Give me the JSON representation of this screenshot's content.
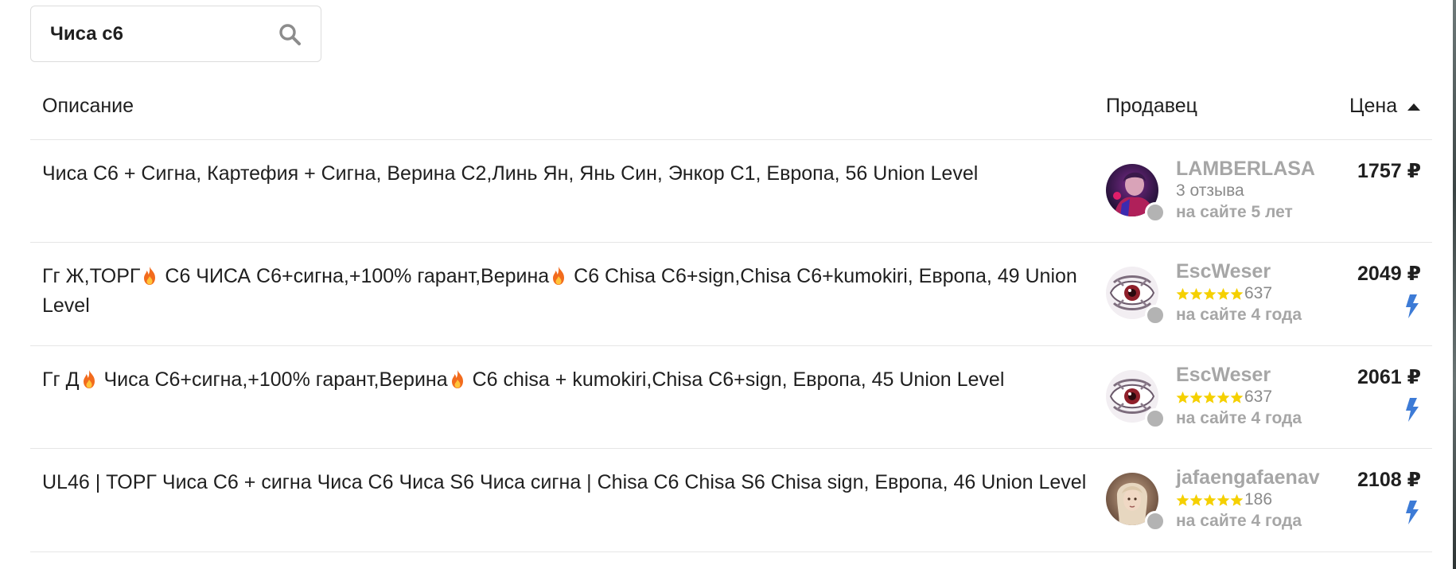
{
  "search": {
    "value": "Чиса с6"
  },
  "table": {
    "headers": {
      "description": "Описание",
      "seller": "Продавец",
      "price": "Цена"
    },
    "sort": {
      "column": "price",
      "direction": "ascending"
    },
    "rows": [
      {
        "segments": [
          "Чиса С6 + Сигна, Картефия + Сигна, Верина С2,Линь Ян, Янь Син, Энкор С1, Европа, 56 Union Level"
        ],
        "seller": {
          "name": "LAMBERLASA",
          "reviews": "3 отзыва",
          "stars": false,
          "since": "на сайте 5 лет",
          "avatar": "dark-character"
        },
        "price": "1757 ₽",
        "auto_delivery": false
      },
      {
        "segments": [
          "Гг Ж,ТОРГ",
          " С6 ЧИСА С6+сигна,+100% гарант,Верина",
          " C6 Chisa C6+sign,Chisa C6+kumokiri, Европа, 49 Union Level"
        ],
        "seller": {
          "name": "EscWeser",
          "reviews": "637",
          "stars": true,
          "since": "на сайте 4 года",
          "avatar": "eye-mask"
        },
        "price": "2049 ₽",
        "auto_delivery": true
      },
      {
        "segments": [
          "Гг Д",
          " Чиса С6+сигна,+100% гарант,Верина",
          " C6 chisa + kumokiri,Chisa C6+sign, Европа, 45 Union Level"
        ],
        "seller": {
          "name": "EscWeser",
          "reviews": "637",
          "stars": true,
          "since": "на сайте 4 года",
          "avatar": "eye-mask"
        },
        "price": "2061 ₽",
        "auto_delivery": true
      },
      {
        "segments": [
          "UL46 | ТОРГ Чиса С6 + сигна Чиса С6 Чиса S6 Чиса сигна | Chisa C6 Chisa S6 Chisa sign, Европа, 46 Union Level"
        ],
        "seller": {
          "name": "jafaengafaenav",
          "reviews": "186",
          "stars": true,
          "since": "на сайте 4 года",
          "avatar": "portrait-girl"
        },
        "price": "2108 ₽",
        "auto_delivery": true
      }
    ]
  },
  "icons": {
    "search": "search-icon",
    "sort": "sort-ascending-icon",
    "fire": "fire-icon",
    "star": "star-icon",
    "bolt": "lightning-bolt-icon"
  },
  "colors": {
    "text": "#1f1f1f",
    "muted": "#a6a6a6",
    "star": "#f5d000",
    "bolt": "#3d7bd6",
    "fire": "#f26b1d",
    "online_dot": "#b3b3b3"
  }
}
